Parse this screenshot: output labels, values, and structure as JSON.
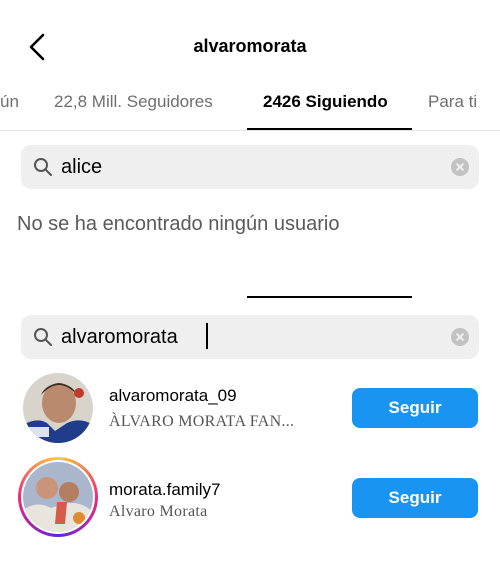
{
  "header": {
    "title": "alvaromorata",
    "back_icon": "chevron-left-icon"
  },
  "tabs": [
    {
      "label": "ún",
      "active": false
    },
    {
      "label": "22,8 Mill. Seguidores",
      "active": false
    },
    {
      "label": "2426 Siguiendo",
      "active": true
    },
    {
      "label": "Para ti",
      "active": false
    }
  ],
  "search_top": {
    "value": "alice",
    "icon": "search-icon",
    "clear_icon": "clear-icon"
  },
  "empty_message": "No se ha encontrado ningún usuario",
  "search_bottom": {
    "value": "alvaromorata",
    "icon": "search-icon",
    "clear_icon": "clear-icon"
  },
  "results": [
    {
      "username": "alvaromorata_09",
      "full_name": "ÀLVARO MORATA FAN...",
      "button": "Seguir",
      "story_ring": false
    },
    {
      "username": "morata.family7",
      "full_name": "Alvaro Morata",
      "button": "Seguir",
      "story_ring": true
    }
  ],
  "colors": {
    "accent_button": "#1a94f3",
    "search_bg": "#efefef",
    "inactive_tab": "#6e6e6e"
  }
}
